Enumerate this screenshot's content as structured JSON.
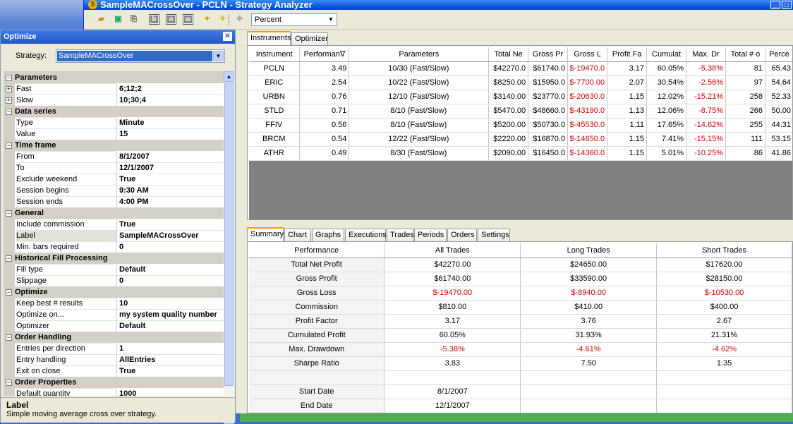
{
  "window": {
    "title": "SampleMACrossOver - PCLN - Strategy Analyzer"
  },
  "toolbar": {
    "buttons": [
      "open-folder-icon",
      "save-icon",
      "export-icon",
      "b",
      "o",
      "w",
      "wand-icon",
      "star-wand-icon",
      "puzzle-icon"
    ],
    "display_combo": "Percent"
  },
  "optimize": {
    "title": "Optimize",
    "strategy_label": "Strategy:",
    "strategy_value": "SampleMACrossOver",
    "rows": [
      {
        "cat": "Parameters"
      },
      {
        "name": "Fast",
        "value": "6;12;2",
        "expand": true
      },
      {
        "name": "Slow",
        "value": "10;30;4",
        "expand": true
      },
      {
        "cat": "Data series"
      },
      {
        "name": "Type",
        "value": "Minute"
      },
      {
        "name": "Value",
        "value": "15"
      },
      {
        "cat": "Time frame"
      },
      {
        "name": "From",
        "value": "8/1/2007"
      },
      {
        "name": "To",
        "value": "12/1/2007"
      },
      {
        "name": "Exclude weekend",
        "value": "True"
      },
      {
        "name": "Session begins",
        "value": "9:30 AM"
      },
      {
        "name": "Session ends",
        "value": "4:00 PM"
      },
      {
        "cat": "General"
      },
      {
        "name": "Include commission",
        "value": "True"
      },
      {
        "name": "Label",
        "value": "SampleMACrossOver",
        "sel": true
      },
      {
        "name": "Min. bars required",
        "value": "0"
      },
      {
        "cat": "Historical Fill Processing"
      },
      {
        "name": "Fill type",
        "value": "Default"
      },
      {
        "name": "Slippage",
        "value": "0"
      },
      {
        "cat": "Optimize"
      },
      {
        "name": "Keep best # results",
        "value": "10"
      },
      {
        "name": "Optimize on...",
        "value": "my system quality number"
      },
      {
        "name": "Optimizer",
        "value": "Default"
      },
      {
        "cat": "Order Handling"
      },
      {
        "name": "Entries per direction",
        "value": "1"
      },
      {
        "name": "Entry handling",
        "value": "AllEntries"
      },
      {
        "name": "Exit on close",
        "value": "True"
      },
      {
        "cat": "Order Properties"
      },
      {
        "name": "Default quantity",
        "value": "1000"
      }
    ],
    "desc_title": "Label",
    "desc_text": "Simple moving average cross over strategy."
  },
  "top_tabs": [
    "Instruments",
    "Optimizer"
  ],
  "instruments": {
    "headers": [
      "Instrument",
      "Performan∇",
      "Parameters",
      "Total Ne",
      "Gross Pr",
      "Gross L",
      "Profit Fa",
      "Cumulat",
      "Max. Dr",
      "Total # o",
      "Perce"
    ],
    "rows": [
      [
        "PCLN",
        "3.49",
        "10/30 (Fast/Slow)",
        "$42270.0",
        "$61740.0",
        "$-19470.0",
        "3.17",
        "60.05%",
        "-5.38%",
        "81",
        "65.43"
      ],
      [
        "ERIC",
        "2.54",
        "10/22 (Fast/Slow)",
        "$8250.00",
        "$15950.0",
        "$-7700.00",
        "2.07",
        "30.54%",
        "-2.56%",
        "97",
        "54.64"
      ],
      [
        "URBN",
        "0.76",
        "12/10 (Fast/Slow)",
        "$3140.00",
        "$23770.0",
        "$-20630.0",
        "1.15",
        "12.02%",
        "-15.21%",
        "258",
        "52.33"
      ],
      [
        "STLD",
        "0.71",
        "8/10 (Fast/Slow)",
        "$5470.00",
        "$48660.0",
        "$-43190.0",
        "1.13",
        "12.06%",
        "-8.75%",
        "266",
        "50.00"
      ],
      [
        "FFIV",
        "0.56",
        "8/10 (Fast/Slow)",
        "$5200.00",
        "$50730.0",
        "$-45530.0",
        "1.11",
        "17.65%",
        "-14.62%",
        "255",
        "44.31"
      ],
      [
        "BRCM",
        "0.54",
        "12/22 (Fast/Slow)",
        "$2220.00",
        "$16870.0",
        "$-14650.0",
        "1.15",
        "7.41%",
        "-15.15%",
        "111",
        "53.15"
      ],
      [
        "ATHR",
        "0.49",
        "8/30 (Fast/Slow)",
        "$2090.00",
        "$16450.0",
        "$-14360.0",
        "1.15",
        "5.01%",
        "-10.25%",
        "86",
        "41.86"
      ]
    ]
  },
  "bottom_tabs": [
    "Summary",
    "Chart",
    "Graphs",
    "Executions",
    "Trades",
    "Periods",
    "Orders",
    "Settings"
  ],
  "summary": {
    "headers": [
      "Performance",
      "All Trades",
      "Long Trades",
      "Short Trades"
    ],
    "rows": [
      [
        "Total Net Profit",
        "$42270.00",
        "$24650.00",
        "$17620.00"
      ],
      [
        "Gross Profit",
        "$61740.00",
        "$33590.00",
        "$28150.00"
      ],
      [
        "Gross Loss",
        "$-19470.00",
        "$-8940.00",
        "$-10530.00"
      ],
      [
        "Commission",
        "$810.00",
        "$410.00",
        "$400.00"
      ],
      [
        "Profit Factor",
        "3.17",
        "3.76",
        "2.67"
      ],
      [
        "Cumulated Profit",
        "60.05%",
        "31.93%",
        "21.31%"
      ],
      [
        "Max. Drawdown",
        "-5.38%",
        "-4.61%",
        "-4.62%"
      ],
      [
        "Sharpe Ratio",
        "3.83",
        "7.50",
        "1.35"
      ],
      [
        "",
        "",
        "",
        ""
      ],
      [
        "Start Date",
        "8/1/2007",
        "",
        ""
      ],
      [
        "End Date",
        "12/1/2007",
        "",
        ""
      ]
    ]
  }
}
